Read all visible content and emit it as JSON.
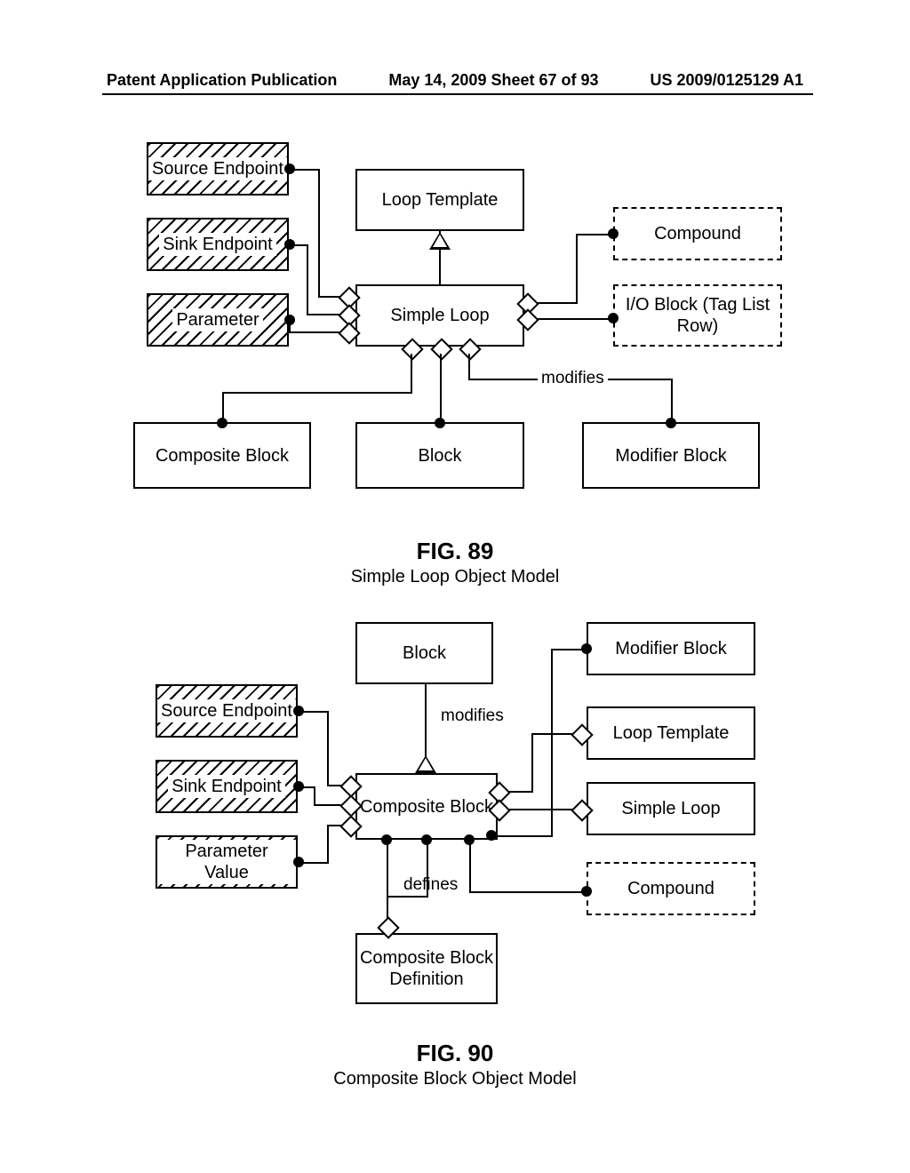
{
  "header": {
    "left": "Patent Application Publication",
    "center": "May 14, 2009  Sheet 67 of 93",
    "right": "US 2009/0125129 A1"
  },
  "fig89": {
    "source_endpoint": "Source Endpoint",
    "sink_endpoint": "Sink Endpoint",
    "parameter": "Parameter",
    "loop_template": "Loop Template",
    "simple_loop": "Simple Loop",
    "compound": "Compound",
    "io_block": "I/O Block (Tag List Row)",
    "composite_block": "Composite Block",
    "block": "Block",
    "modifier_block": "Modifier Block",
    "modifies": "modifies",
    "figure_number": "FIG. 89",
    "figure_title": "Simple Loop Object Model"
  },
  "fig90": {
    "block": "Block",
    "source_endpoint": "Source Endpoint",
    "sink_endpoint": "Sink Endpoint",
    "parameter_value": "Parameter Value",
    "composite_block": "Composite Block",
    "modifier_block": "Modifier Block",
    "loop_template": "Loop Template",
    "simple_loop": "Simple Loop",
    "compound": "Compound",
    "composite_block_def": "Composite Block Definition",
    "modifies": "modifies",
    "defines": "defines",
    "figure_number": "FIG. 90",
    "figure_title": "Composite Block Object Model"
  }
}
